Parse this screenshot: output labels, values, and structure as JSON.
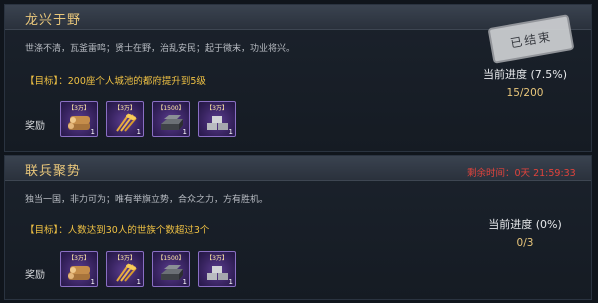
{
  "quests": [
    {
      "title": "龙兴于野",
      "description": "世涤不清，瓦釜雷鸣；贤士在野，治乱安民；起于微末，功业将兴。",
      "goal": "【目标】：200座个人城池的都府提升到5级",
      "reward_label": "奖励",
      "rewards": [
        {
          "tag": "【3万】",
          "count": "1",
          "icon": "wood-logs-icon"
        },
        {
          "tag": "【3万】",
          "count": "1",
          "icon": "wheat-icon"
        },
        {
          "tag": "【1500】",
          "count": "1",
          "icon": "iron-ingot-icon"
        },
        {
          "tag": "【3万】",
          "count": "1",
          "icon": "stone-bricks-icon"
        }
      ],
      "status_stamp": "已结束",
      "progress_label": "当前进度 (7.5%)",
      "progress_value": "15/200",
      "progress_fraction": 0.075
    },
    {
      "title": "联兵聚势",
      "description": "独当一国，非力可为；唯有举旗立势，合众之力，方有胜机。",
      "goal": "【目标】：人数达到30人的世族个数超过3个",
      "reward_label": "奖励",
      "rewards": [
        {
          "tag": "【3万】",
          "count": "1",
          "icon": "wood-logs-icon"
        },
        {
          "tag": "【3万】",
          "count": "1",
          "icon": "wheat-icon"
        },
        {
          "tag": "【1500】",
          "count": "1",
          "icon": "iron-ingot-icon"
        },
        {
          "tag": "【3万】",
          "count": "1",
          "icon": "stone-bricks-icon"
        }
      ],
      "timer": "剩余时间：0天 21:59:33",
      "progress_label": "当前进度 (0%)",
      "progress_value": "0/3",
      "progress_fraction": 0
    }
  ],
  "colors": {
    "title_gold": "#e9c77b",
    "goal_yellow": "#f0c244",
    "timer_red": "#e2433c",
    "item_purple": "#5b3d8f"
  }
}
